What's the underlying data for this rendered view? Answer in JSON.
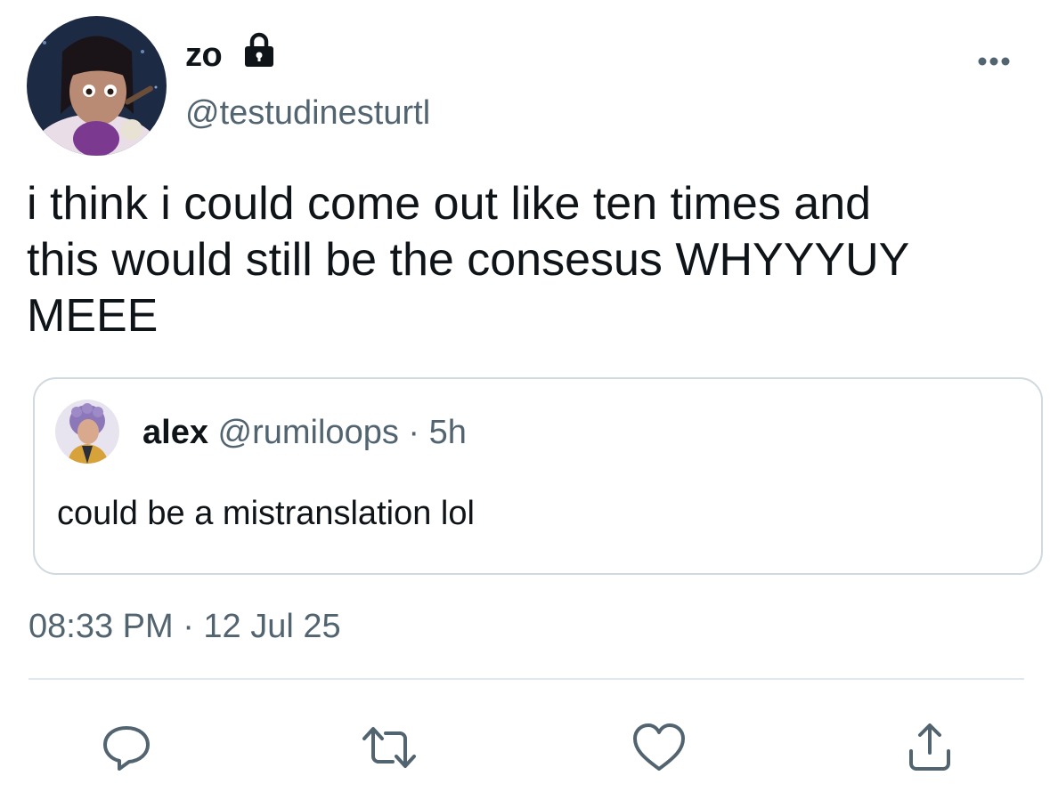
{
  "author": {
    "display_name": "zo",
    "handle": "@testudinesturtl",
    "avatar_icon": "user-avatar",
    "protected_icon": "lock-icon"
  },
  "tweet": {
    "text": "i think i could come out like ten times and\nthis would still be the consesus WHYYYUY\nMEEE",
    "timestamp": "08:33 PM · 12 Jul 25"
  },
  "quoted_tweet": {
    "display_name": "alex",
    "handle": "@rumiloops",
    "separator": "·",
    "age": "5h",
    "text": "could be a mistranslation lol"
  },
  "actions": [
    {
      "name": "reply",
      "icon": "reply-icon"
    },
    {
      "name": "retweet",
      "icon": "retweet-icon"
    },
    {
      "name": "like",
      "icon": "heart-icon"
    },
    {
      "name": "share",
      "icon": "share-icon"
    }
  ],
  "colors": {
    "text_primary": "#0f1419",
    "text_secondary": "#536471",
    "border": "#cfd9de",
    "divider": "#e1e8ed"
  }
}
